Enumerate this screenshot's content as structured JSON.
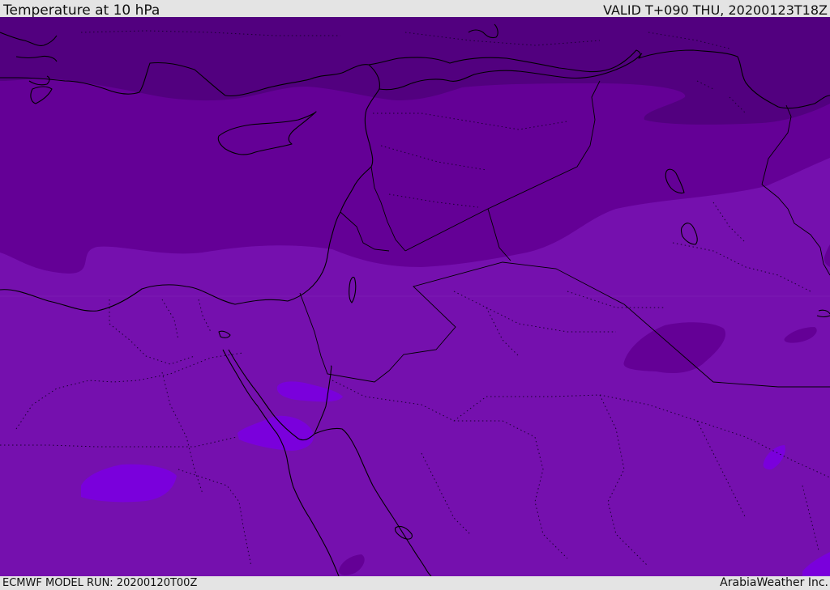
{
  "header": {
    "title": "Temperature at 10 hPa",
    "valid": "VALID T+090 THU, 20200123T18Z"
  },
  "footer": {
    "model_run": "ECMWF MODEL RUN: 20200120T00Z",
    "credit": "ArabiaWeather Inc."
  },
  "colors": {
    "band_darkest": "#52007f",
    "band_dark": "#640096",
    "band_mid": "#7510ae",
    "band_light": "#7a00dc",
    "coastline": "#000000",
    "chrome_background": "#e4e4e4"
  }
}
